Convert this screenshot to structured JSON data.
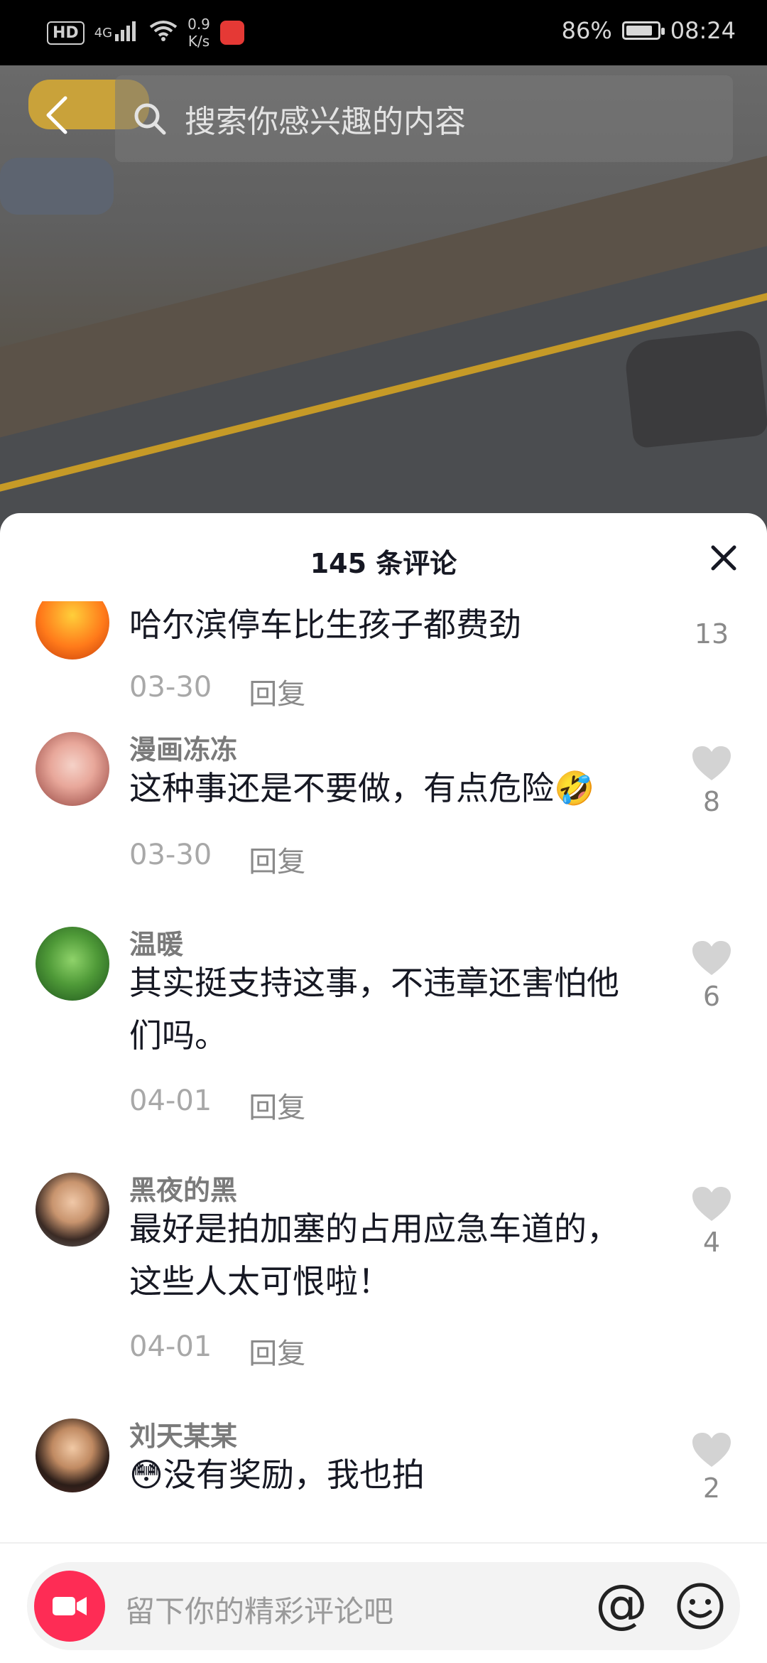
{
  "status_bar": {
    "hd": "HD",
    "signal": "4G",
    "speed_value": "0.9",
    "speed_unit": "K/s",
    "battery": "86%",
    "battery_level": 0.86,
    "time": "08:24"
  },
  "search": {
    "placeholder": "搜索你感兴趣的内容"
  },
  "sheet": {
    "title": "145 条评论",
    "comments": [
      {
        "username": "",
        "text": "哈尔滨停车比生孩子都费劲",
        "date": "03-30",
        "reply": "回复",
        "likes": "13"
      },
      {
        "username": "漫画冻冻",
        "text": "这种事还是不要做，有点危险🤣",
        "date": "03-30",
        "reply": "回复",
        "likes": "8"
      },
      {
        "username": "温暖",
        "text": "其实挺支持这事，不违章还害怕他们吗。",
        "date": "04-01",
        "reply": "回复",
        "likes": "6"
      },
      {
        "username": "黑夜的黑",
        "text": "最好是拍加塞的占用应急车道的，这些人太可恨啦！",
        "date": "04-01",
        "reply": "回复",
        "likes": "4"
      },
      {
        "username": "刘天某某",
        "text": "😳没有奖励，我也拍",
        "date": "",
        "reply": "",
        "likes": "2"
      }
    ]
  },
  "bottom": {
    "input_placeholder": "留下你的精彩评论吧",
    "at_symbol": "@"
  },
  "colors": {
    "accent": "#fe2c55",
    "text": "#161823",
    "muted": "#a8a8a8"
  }
}
